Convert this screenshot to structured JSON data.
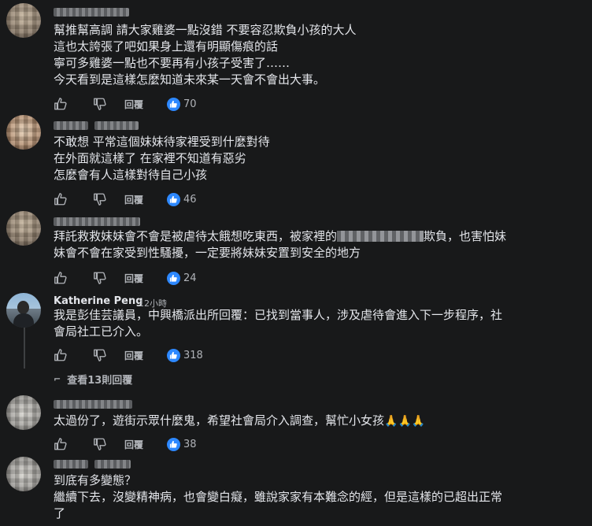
{
  "comments": [
    {
      "author": "",
      "time": "",
      "lines": [
        "幫推幫高調 請大家雞婆一點沒錯 不要容忍欺負小孩的大人",
        "這也太誇張了吧如果身上還有明顯傷痕的話",
        "寧可多雞婆一點也不要再有小孩子受害了……",
        "今天看到是這樣怎麼知道未來某一天會不會出大事。"
      ],
      "reply_label": "回覆",
      "like_count": "70"
    },
    {
      "author": "",
      "time": "",
      "lines": [
        "不敢想 平常這個妹妹待家裡受到什麼對待",
        "在外面就這樣了 在家裡不知道有惡劣",
        "怎麼會有人這樣對待自己小孩"
      ],
      "reply_label": "回覆",
      "like_count": "46"
    },
    {
      "author": "",
      "time": "",
      "line1_pre": "拜託救救妹妹會不會是被虐待太餓想吃東西，被家裡的",
      "line1_post": "欺負，也害怕妹",
      "line2": "妹會不會在家受到性騷擾，一定要將妹妹安置到安全的地方",
      "reply_label": "回覆",
      "like_count": "24"
    },
    {
      "author": "Katherine Peng",
      "time": "12小時",
      "lines": [
        "我是彭佳芸議員，中興橋派出所回覆：已找到當事人，涉及虐待會進入下一步程序，社",
        "會局社工已介入。"
      ],
      "reply_label": "回覆",
      "like_count": "318",
      "view_replies": "查看13則回覆"
    },
    {
      "author": "",
      "time": "",
      "text": "太過份了，遊街示眾什麼鬼，希望社會局介入調查，幫忙小女孩",
      "emoji": "🙏🙏🙏",
      "reply_label": "回覆",
      "like_count": "38"
    },
    {
      "author": "",
      "time": "",
      "lines": [
        "到底有多變態？",
        "繼續下去，沒變精神病，也會變白癡，雖說家家有本難念的經，但是這樣的已超出正常",
        "了"
      ]
    }
  ],
  "icons": {
    "like": "thumbs-up-icon",
    "dislike": "thumbs-down-icon",
    "reaction": "like-reaction-icon",
    "expand": "reply-arrow-icon"
  },
  "colors": {
    "background": "#18191a",
    "text": "#e4e6eb",
    "secondary": "#b0b3b8",
    "like_badge": "#2d88ff"
  }
}
